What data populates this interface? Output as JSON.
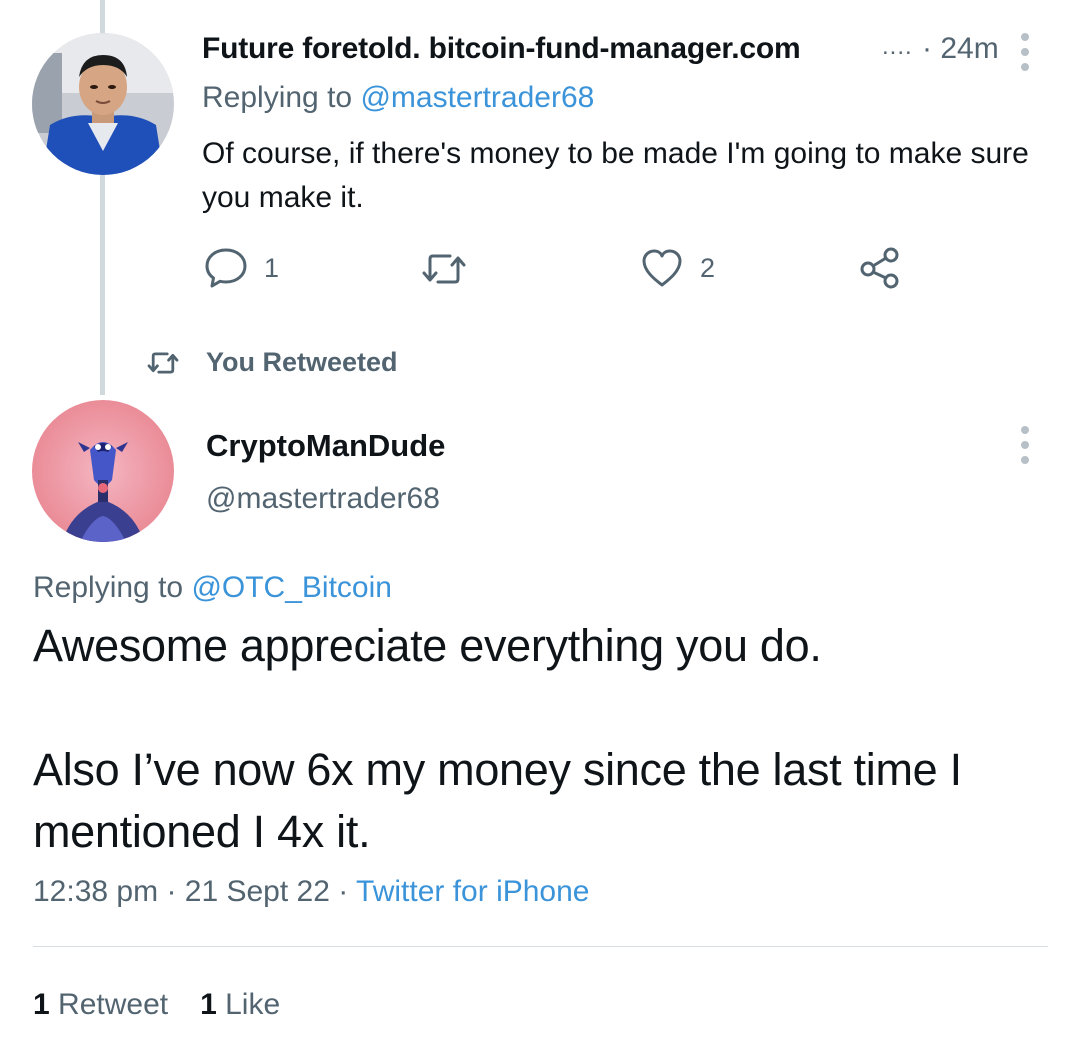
{
  "reply_tweet": {
    "display_name": "Future foretold. bitcoin-fund-manager.com",
    "truncation": "....",
    "time": "· 24m",
    "replying_prefix": "Replying to",
    "replying_handle": "@mastertrader68",
    "text": "Of course, if there's money to be made I'm going to make sure you make it.",
    "reply_count": "1",
    "like_count": "2",
    "icons": {
      "avatar": "profile-photo",
      "more": "more-vertical-icon",
      "reply": "comment-icon",
      "retweet": "retweet-icon",
      "like": "heart-icon",
      "share": "share-icon"
    }
  },
  "retweet_context": {
    "label": "You Retweeted",
    "icon": "retweet-icon"
  },
  "main_tweet": {
    "display_name": "CryptoManDude",
    "handle": "@mastertrader68",
    "replying_prefix": "Replying to",
    "replying_handle": "@OTC_Bitcoin",
    "paragraph_1": "Awesome appreciate everything you do.",
    "paragraph_2": "Also I’ve now 6x my money since the last time I mentioned I 4x it.",
    "time": "12:38 pm",
    "date": "21 Sept 22",
    "separator": "·",
    "source": "Twitter for iPhone",
    "retweet_count": "1",
    "retweet_label": "Retweet",
    "like_count": "1",
    "like_label": "Like"
  },
  "colors": {
    "text_primary": "#0f1419",
    "text_secondary": "#536471",
    "link": "#3b94d9",
    "thread_line": "#cfd9de",
    "divider": "#d7dde1"
  }
}
